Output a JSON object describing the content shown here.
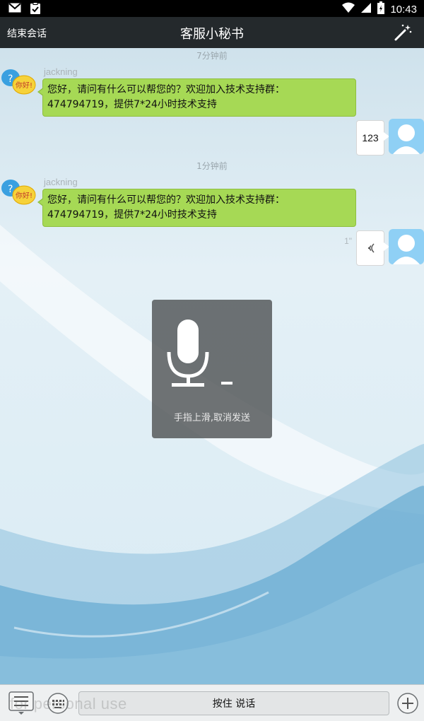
{
  "status_bar": {
    "time": "10:43"
  },
  "header": {
    "end_session": "结束会话",
    "title": "客服小秘书"
  },
  "messages": [
    {
      "time_divider": "7分钟前",
      "sender": "jackning",
      "avatar_badge": "你好!",
      "text_line1": "您好，请问有什么可以帮您的？欢迎加入技术支持群：",
      "text_line2": "474794719，提供7*24小时技术支持",
      "reply": "123"
    },
    {
      "time_divider": "1分钟前",
      "sender": "jackning",
      "avatar_badge": "你好!",
      "text_line1": "您好，请问有什么可以帮您的？欢迎加入技术支持群：",
      "text_line2": "474794719，提供7*24小时技术支持",
      "voice_duration": "1\""
    }
  ],
  "recording": {
    "hint": "手指上滑,取消发送"
  },
  "bottom_bar": {
    "talk_button": "按住 说话",
    "watermark": "for personal use"
  },
  "icons": [
    "gmail-icon",
    "clipboard-icon",
    "wifi-icon",
    "signal-icon",
    "battery-icon",
    "magic-wand-icon",
    "microphone-icon",
    "voice-wave-icon",
    "menu-icon",
    "keyboard-icon",
    "plus-icon"
  ],
  "colors": {
    "title_bar": "#24292c",
    "incoming_bubble": "#a6d955",
    "accent_avatar": "#8fd0f5"
  }
}
